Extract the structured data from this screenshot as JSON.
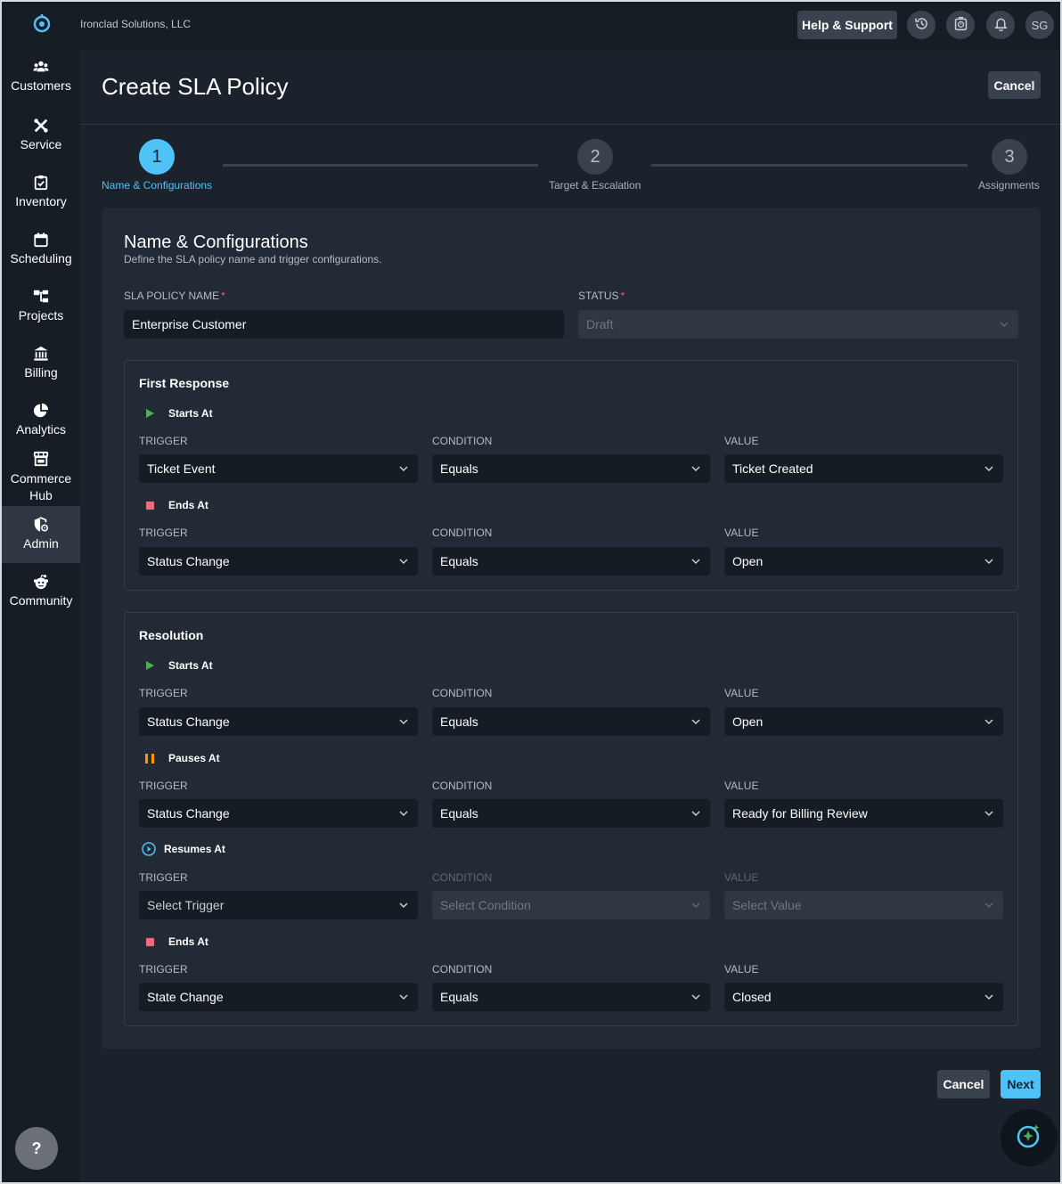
{
  "topbar": {
    "org_name": "Ironclad Solutions, LLC",
    "help_label": "Help & Support",
    "avatar_initials": "SG"
  },
  "sidebar": {
    "items": [
      {
        "label": "Customers",
        "icon": "users-icon"
      },
      {
        "label": "Service",
        "icon": "tools-icon"
      },
      {
        "label": "Inventory",
        "icon": "clipboard-icon"
      },
      {
        "label": "Scheduling",
        "icon": "calendar-icon"
      },
      {
        "label": "Projects",
        "icon": "hierarchy-icon"
      },
      {
        "label": "Billing",
        "icon": "bank-icon"
      },
      {
        "label": "Analytics",
        "icon": "pie-chart-icon"
      },
      {
        "label": "Commerce Hub",
        "icon": "storefront-icon"
      },
      {
        "label": "Admin",
        "icon": "shield-gear-icon"
      },
      {
        "label": "Community",
        "icon": "community-icon"
      }
    ],
    "active": "Admin",
    "help_fab": "?"
  },
  "header": {
    "title": "Create SLA Policy",
    "cancel_label": "Cancel"
  },
  "stepper": {
    "steps": [
      {
        "number": "1",
        "label": "Name & Configurations"
      },
      {
        "number": "2",
        "label": "Target & Escalation"
      },
      {
        "number": "3",
        "label": "Assignments"
      }
    ],
    "current_step": 1
  },
  "form": {
    "title": "Name & Configurations",
    "subtitle": "Define the SLA policy name and trigger configurations.",
    "policy_name_label": "SLA POLICY NAME",
    "policy_name_value": "Enterprise Customer",
    "status_label": "STATUS",
    "status_value": "Draft",
    "required_mark": "*",
    "trigger_label": "TRIGGER",
    "condition_label": "CONDITION",
    "value_label": "VALUE"
  },
  "first_response": {
    "title": "First Response",
    "starts": {
      "label": "Starts At",
      "trigger": "Ticket Event",
      "condition": "Equals",
      "value": "Ticket Created"
    },
    "ends": {
      "label": "Ends At",
      "trigger": "Status Change",
      "condition": "Equals",
      "value": "Open"
    }
  },
  "resolution": {
    "title": "Resolution",
    "starts": {
      "label": "Starts At",
      "trigger": "Status Change",
      "condition": "Equals",
      "value": "Open"
    },
    "pauses": {
      "label": "Pauses At",
      "trigger": "Status Change",
      "condition": "Equals",
      "value": "Ready for Billing Review"
    },
    "resumes": {
      "label": "Resumes At",
      "trigger": "Select Trigger",
      "condition": "Select Condition",
      "value": "Select Value"
    },
    "ends": {
      "label": "Ends At",
      "trigger": "State Change",
      "condition": "Equals",
      "value": "Closed"
    }
  },
  "footer": {
    "cancel_label": "Cancel",
    "next_label": "Next"
  },
  "colors": {
    "accent": "#4fc3f7",
    "start": "#4caf50",
    "end": "#f06b7a",
    "pause": "#ff9800",
    "resume": "#4fc3f7"
  }
}
